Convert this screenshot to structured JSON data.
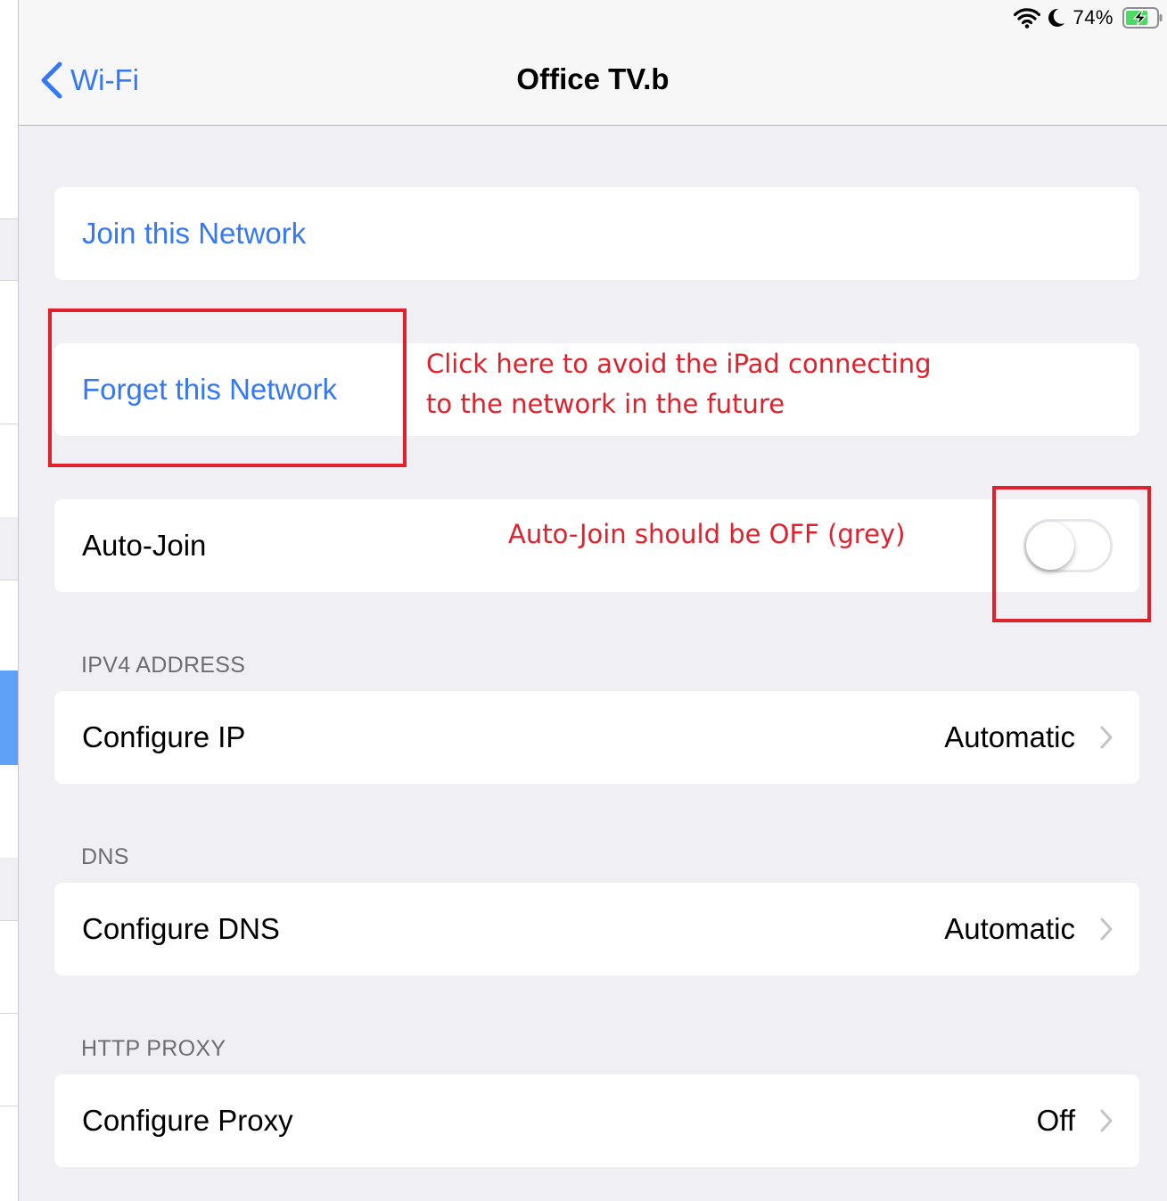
{
  "status_bar": {
    "battery_percent": "74%",
    "wifi_icon": "wifi-icon",
    "moon_icon": "moon-icon",
    "battery_icon": "battery-charging-icon"
  },
  "nav": {
    "back_label": "Wi-Fi",
    "title": "Office TV.b"
  },
  "actions": {
    "join_label": "Join this Network",
    "forget_label": "Forget this Network"
  },
  "auto_join": {
    "label": "Auto-Join",
    "enabled": false
  },
  "sections": {
    "ipv4": {
      "header": "IPV4 ADDRESS",
      "label": "Configure IP",
      "value": "Automatic"
    },
    "dns": {
      "header": "DNS",
      "label": "Configure DNS",
      "value": "Automatic"
    },
    "proxy": {
      "header": "HTTP PROXY",
      "label": "Configure Proxy",
      "value": "Off"
    }
  },
  "annotations": {
    "forget_note_line1": "Click here to avoid the iPad connecting",
    "forget_note_line2": "to the network in the future",
    "autojoin_note": "Auto-Join should be OFF (grey)"
  },
  "colors": {
    "accent": "#3478f6",
    "annotation": "#e0202b",
    "background": "#efeff4"
  }
}
